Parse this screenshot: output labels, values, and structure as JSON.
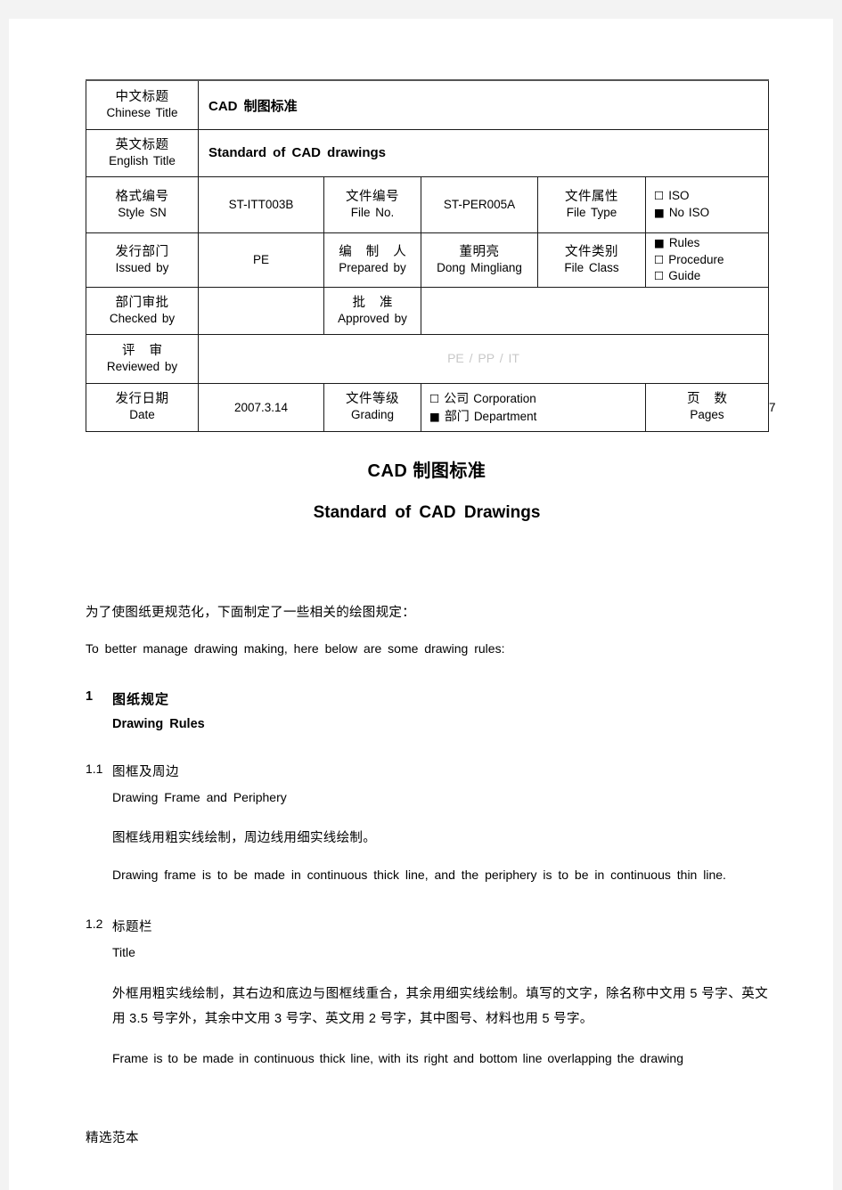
{
  "header_table": {
    "rows": [
      {
        "label_cn": "中文标题",
        "label_en": "Chinese Title",
        "value": "CAD 制图标准"
      },
      {
        "label_cn": "英文标题",
        "label_en": "English Title",
        "value": "Standard of CAD drawings"
      }
    ],
    "row3": {
      "style_sn": {
        "cn": "格式编号",
        "en": "Style SN",
        "value": "ST-ITT003B"
      },
      "file_no": {
        "cn": "文件编号",
        "en": "File No.",
        "value": "ST-PER005A"
      },
      "file_type": {
        "cn": "文件属性",
        "en": "File Type",
        "options": [
          {
            "label": "ISO",
            "checked": false
          },
          {
            "label": "No ISO",
            "checked": true
          }
        ]
      }
    },
    "row4": {
      "issued_by": {
        "cn": "发行部门",
        "en": "Issued by",
        "value": "PE"
      },
      "prepared_by": {
        "cn": "编 制 人",
        "en": "Prepared by",
        "value_cn": "董明亮",
        "value_en": "Dong Mingliang"
      },
      "file_class": {
        "cn": "文件类别",
        "en": "File Class",
        "options": [
          {
            "label": "Rules",
            "checked": true
          },
          {
            "label": "Procedure",
            "checked": false
          },
          {
            "label": "Guide",
            "checked": false
          }
        ]
      }
    },
    "row5": {
      "checked_by": {
        "cn": "部门审批",
        "en": "Checked by",
        "value": ""
      },
      "approved_by": {
        "cn": "批    准",
        "en": "Approved by",
        "value": ""
      }
    },
    "row6": {
      "reviewed_by": {
        "cn": "评    审",
        "en": "Reviewed by",
        "value": "PE / PP / IT"
      }
    },
    "row7": {
      "date": {
        "cn": "发行日期",
        "en": "Date",
        "value": "2007.3.14"
      },
      "grading": {
        "cn": "文件等级",
        "en": "Grading",
        "options": [
          {
            "cn": "公司",
            "en": "Corporation",
            "checked": false
          },
          {
            "cn": "部门",
            "en": "Department",
            "checked": true
          }
        ]
      },
      "pages": {
        "cn": "页    数",
        "en": "Pages",
        "value": "7"
      }
    }
  },
  "document": {
    "title_cn": "CAD 制图标准",
    "title_en": "Standard of CAD Drawings",
    "intro_cn": "为了使图纸更规范化，下面制定了一些相关的绘图规定：",
    "intro_en": "To better manage drawing making, here below are some drawing rules:",
    "section1": {
      "number": "1",
      "title_cn": "图纸规定",
      "title_en": "Drawing Rules"
    },
    "section1_1": {
      "number": "1.1",
      "title_cn": "图框及周边",
      "title_en": "Drawing Frame and Periphery",
      "body_cn": "图框线用粗实线绘制，周边线用细实线绘制。",
      "body_en": "Drawing frame is to be made in continuous thick line, and the periphery is to be in continuous thin line."
    },
    "section1_2": {
      "number": "1.2",
      "title_cn": "标题栏",
      "title_en": "Title",
      "body_cn": "外框用粗实线绘制，其右边和底边与图框线重合，其余用细实线绘制。填写的文字，除名称中文用 5 号字、英文用 3.5 号字外，其余中文用 3 号字、英文用 2 号字，其中图号、材料也用 5 号字。",
      "body_en": "Frame is to be made in continuous thick line, with its right and bottom line overlapping the drawing"
    }
  },
  "footer": {
    "text": "精选范本"
  },
  "glyphs": {
    "checkbox_empty": "☐",
    "checkbox_filled": "■"
  }
}
